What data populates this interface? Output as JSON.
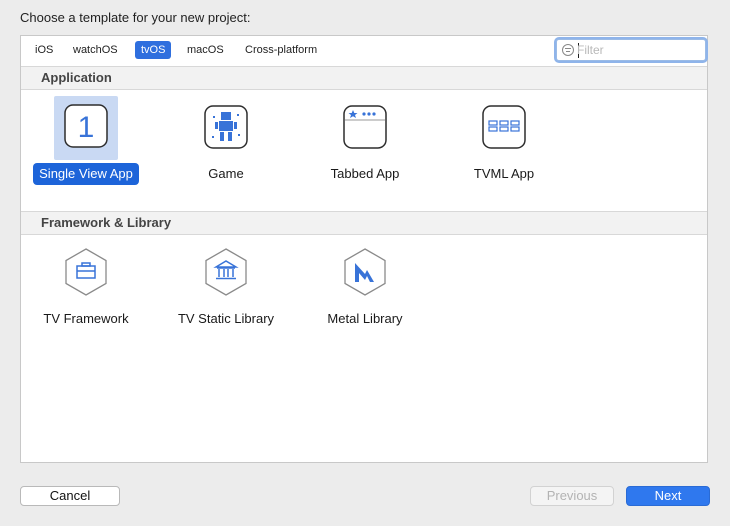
{
  "header": {
    "title": "Choose a template for your new project:"
  },
  "platform_tabs": [
    {
      "label": "iOS",
      "active": false
    },
    {
      "label": "watchOS",
      "active": false
    },
    {
      "label": "tvOS",
      "active": true
    },
    {
      "label": "macOS",
      "active": false
    },
    {
      "label": "Cross-platform",
      "active": false
    }
  ],
  "filter": {
    "placeholder": "Filter",
    "value": ""
  },
  "sections": [
    {
      "title": "Application",
      "templates": [
        {
          "label": "Single View App",
          "icon": "single-view-app-icon",
          "selected": true
        },
        {
          "label": "Game",
          "icon": "game-icon",
          "selected": false
        },
        {
          "label": "Tabbed App",
          "icon": "tabbed-app-icon",
          "selected": false
        },
        {
          "label": "TVML App",
          "icon": "tvml-app-icon",
          "selected": false
        }
      ]
    },
    {
      "title": "Framework & Library",
      "templates": [
        {
          "label": "TV Framework",
          "icon": "framework-icon",
          "selected": false
        },
        {
          "label": "TV Static Library",
          "icon": "static-library-icon",
          "selected": false
        },
        {
          "label": "Metal Library",
          "icon": "metal-library-icon",
          "selected": false
        }
      ]
    }
  ],
  "buttons": {
    "cancel": "Cancel",
    "previous": "Previous",
    "next": "Next"
  },
  "colors": {
    "accent": "#2f78ee",
    "selection": "#1d64d9",
    "icon_blue": "#3873d8"
  }
}
